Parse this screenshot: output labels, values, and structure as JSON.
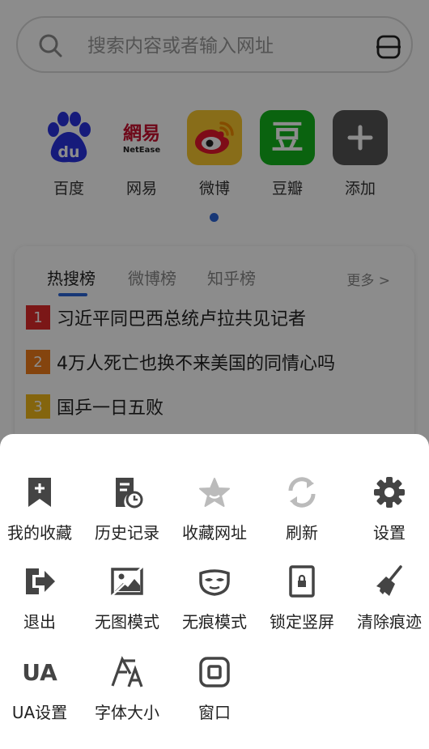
{
  "search": {
    "placeholder": "搜索内容或者输入网址"
  },
  "shortcuts": [
    {
      "label": "百度",
      "icon": "baidu-logo-icon"
    },
    {
      "label": "网易",
      "icon": "netease-logo-icon",
      "logo_cn": "網易",
      "logo_en": "NetEase"
    },
    {
      "label": "微博",
      "icon": "weibo-logo-icon"
    },
    {
      "label": "豆瓣",
      "icon": "douban-logo-icon",
      "logo_char": "豆"
    },
    {
      "label": "添加",
      "icon": "add-icon"
    }
  ],
  "hot": {
    "tabs": [
      "热搜榜",
      "微博榜",
      "知乎榜"
    ],
    "more": "更多 >",
    "items": [
      {
        "rank": "1",
        "text": "习近平同巴西总统卢拉共见记者",
        "color": "#e02b2b"
      },
      {
        "rank": "2",
        "text": "4万人死亡也换不来美国的同情心吗",
        "color": "#f07d1a"
      },
      {
        "rank": "3",
        "text": "国乒一日五败",
        "color": "#f0b81a"
      }
    ]
  },
  "menu": {
    "items": [
      {
        "label": "我的收藏",
        "icon": "bookmark-add-icon"
      },
      {
        "label": "历史记录",
        "icon": "history-icon"
      },
      {
        "label": "收藏网址",
        "icon": "star-icon"
      },
      {
        "label": "刷新",
        "icon": "refresh-icon"
      },
      {
        "label": "设置",
        "icon": "gear-icon"
      },
      {
        "label": "退出",
        "icon": "exit-icon"
      },
      {
        "label": "无图模式",
        "icon": "no-image-icon"
      },
      {
        "label": "无痕模式",
        "icon": "incognito-mask-icon"
      },
      {
        "label": "锁定竖屏",
        "icon": "lock-portrait-icon"
      },
      {
        "label": "清除痕迹",
        "icon": "broom-icon"
      },
      {
        "label": "UA设置",
        "icon": "ua-icon",
        "icon_text": "UA"
      },
      {
        "label": "字体大小",
        "icon": "font-size-icon"
      },
      {
        "label": "窗口",
        "icon": "window-icon"
      }
    ]
  },
  "colors": {
    "accent": "#2a64d8",
    "icon_gray": "#444444"
  }
}
